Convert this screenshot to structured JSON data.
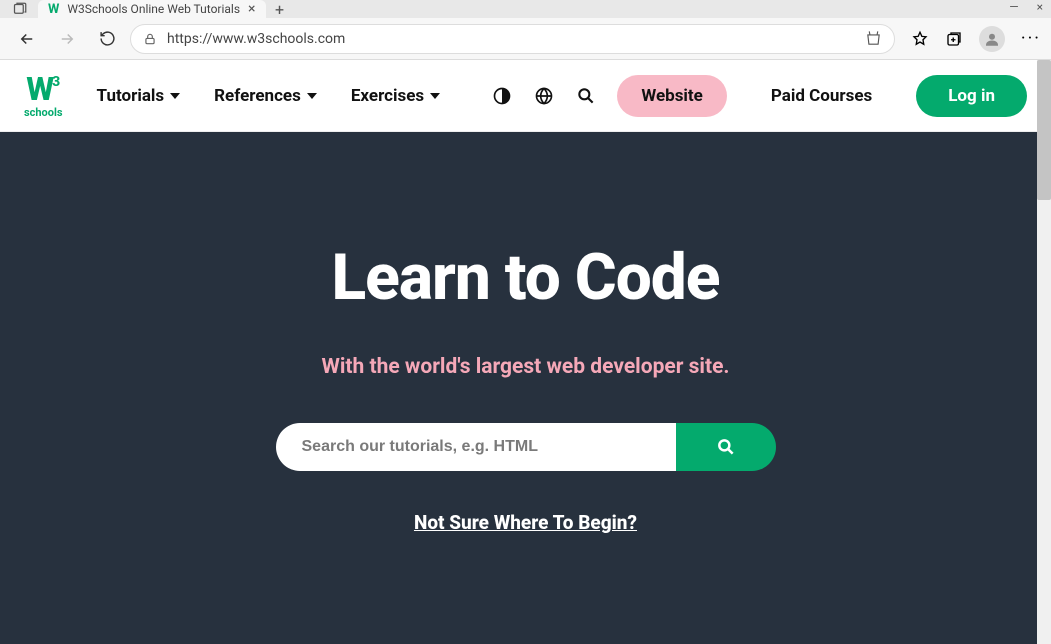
{
  "browser": {
    "tab_title": "W3Schools Online Web Tutorials",
    "url": "https://www.w3schools.com"
  },
  "nav": {
    "logo_top": "W",
    "logo_sup": "3",
    "logo_sub": "schools",
    "tutorials": "Tutorials",
    "references": "References",
    "exercises": "Exercises",
    "website": "Website",
    "paid_courses": "Paid Courses",
    "login": "Log in"
  },
  "hero": {
    "headline": "Learn to Code",
    "subhead": "With the world's largest web developer site.",
    "search_placeholder": "Search our tutorials, e.g. HTML",
    "begin_link": "Not Sure Where To Begin?"
  },
  "colors": {
    "brand_green": "#04aa6d",
    "hero_bg": "#27313e",
    "pink": "#f8b9c6",
    "pink_text": "#f5a8b8"
  }
}
